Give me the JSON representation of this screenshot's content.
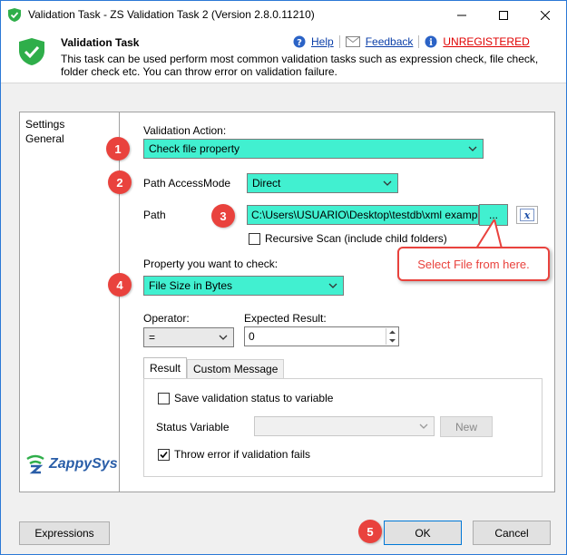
{
  "window": {
    "title": "Validation Task - ZS Validation Task 2 (Version 2.8.0.11210)"
  },
  "header": {
    "title": "Validation Task",
    "description": "This task can be used perform most common validation tasks such as expression check, file check, folder check etc. You can throw error on validation failure.",
    "help_label": "Help",
    "feedback_label": "Feedback",
    "unregistered_label": "UNREGISTERED"
  },
  "nav": {
    "items": [
      {
        "label": "Settings"
      },
      {
        "label": "General"
      }
    ]
  },
  "brand": {
    "logo_text": "ZappySys"
  },
  "form": {
    "validation_action_label": "Validation Action:",
    "validation_action_value": "Check file property",
    "path_access_mode_label": "Path AccessMode",
    "path_access_mode_value": "Direct",
    "path_label": "Path",
    "path_value": "C:\\Users\\USUARIO\\Desktop\\testdb\\xml exampl",
    "browse_label": "...",
    "recursive_label": "Recursive Scan (include child folders)",
    "property_label": "Property you want to check:",
    "property_value": "File Size in Bytes",
    "operator_label": "Operator:",
    "operator_value": "=",
    "expected_label": "Expected Result:",
    "expected_value": "0"
  },
  "tabs": [
    {
      "label": "Result"
    },
    {
      "label": "Custom Message"
    }
  ],
  "result_tab": {
    "save_status_label": "Save validation status to variable",
    "status_variable_label": "Status Variable",
    "new_button_label": "New",
    "throw_error_label": "Throw error if validation fails"
  },
  "callout": {
    "text": "Select File from here."
  },
  "badges": [
    "1",
    "2",
    "3",
    "4",
    "5"
  ],
  "footer": {
    "expressions_label": "Expressions",
    "ok_label": "OK",
    "cancel_label": "Cancel"
  },
  "colors": {
    "highlight": "#41f0d0",
    "badge": "#e9423d",
    "link": "#0b3fa8",
    "unregistered": "#e00000"
  }
}
